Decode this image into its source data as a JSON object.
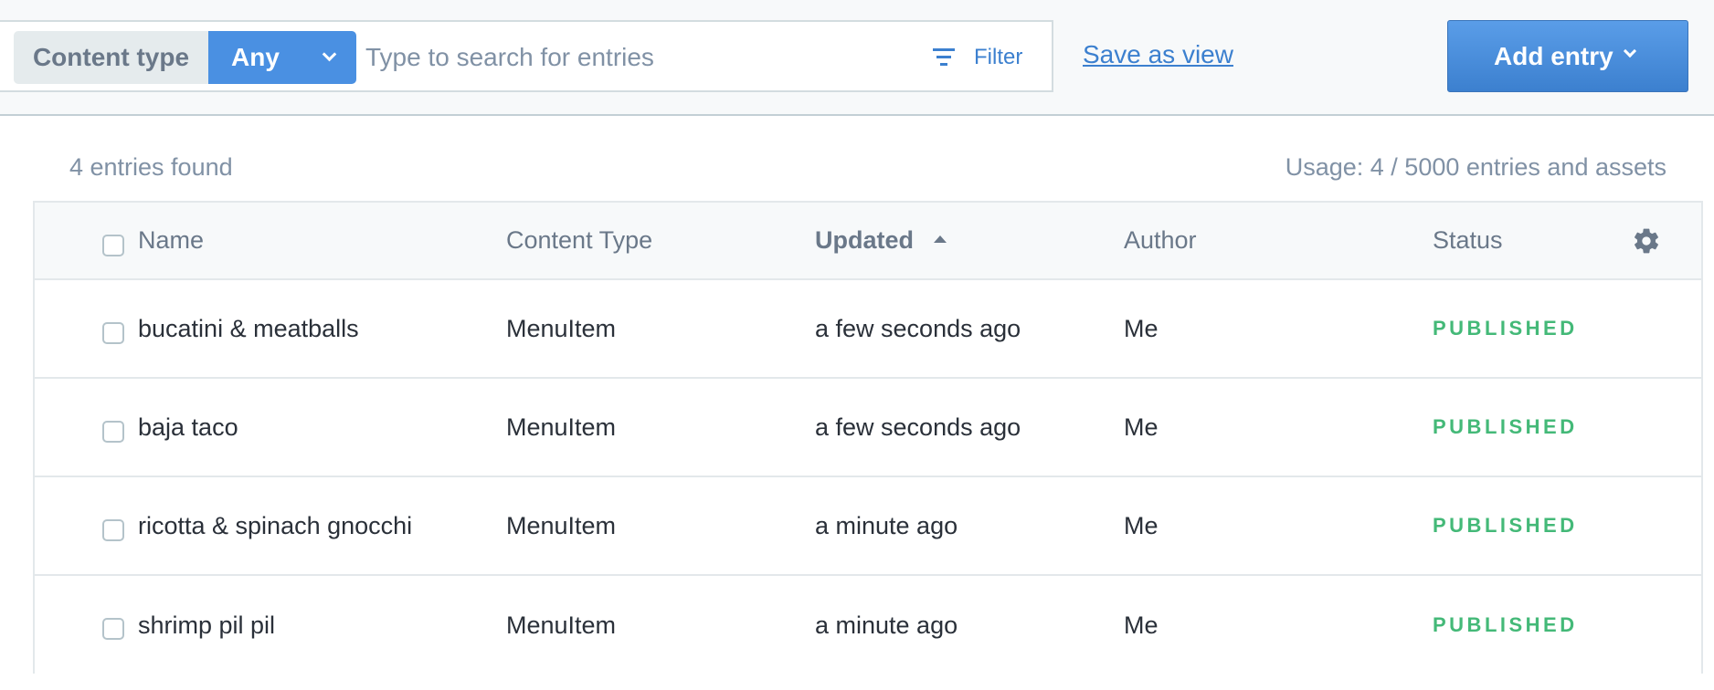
{
  "toolbar": {
    "content_type_label": "Content type",
    "content_type_value": "Any",
    "search_placeholder": "Type to search for entries",
    "filter_label": "Filter",
    "save_view_label": "Save as view",
    "add_entry_label": "Add entry"
  },
  "summary": {
    "found": "4 entries found",
    "usage": "Usage: 4 / 5000 entries and assets"
  },
  "table": {
    "columns": {
      "name": "Name",
      "content_type": "Content Type",
      "updated": "Updated",
      "author": "Author",
      "status": "Status"
    },
    "sort": {
      "column": "updated",
      "direction": "ascending"
    },
    "rows": [
      {
        "name": "bucatini & meatballs",
        "content_type": "MenuItem",
        "updated": "a few seconds ago",
        "author": "Me",
        "status": "PUBLISHED"
      },
      {
        "name": "baja taco",
        "content_type": "MenuItem",
        "updated": "a few seconds ago",
        "author": "Me",
        "status": "PUBLISHED"
      },
      {
        "name": "ricotta & spinach gnocchi",
        "content_type": "MenuItem",
        "updated": "a minute ago",
        "author": "Me",
        "status": "PUBLISHED"
      },
      {
        "name": "shrimp pil pil",
        "content_type": "MenuItem",
        "updated": "a minute ago",
        "author": "Me",
        "status": "PUBLISHED"
      }
    ]
  },
  "colors": {
    "accent": "#4a90e2",
    "link": "#3c80cf",
    "published": "#44b978",
    "muted_text": "#8091a5"
  },
  "icons": [
    "chevron-down-icon",
    "filter-icon",
    "sort-ascending-icon",
    "gear-icon",
    "checkbox"
  ]
}
